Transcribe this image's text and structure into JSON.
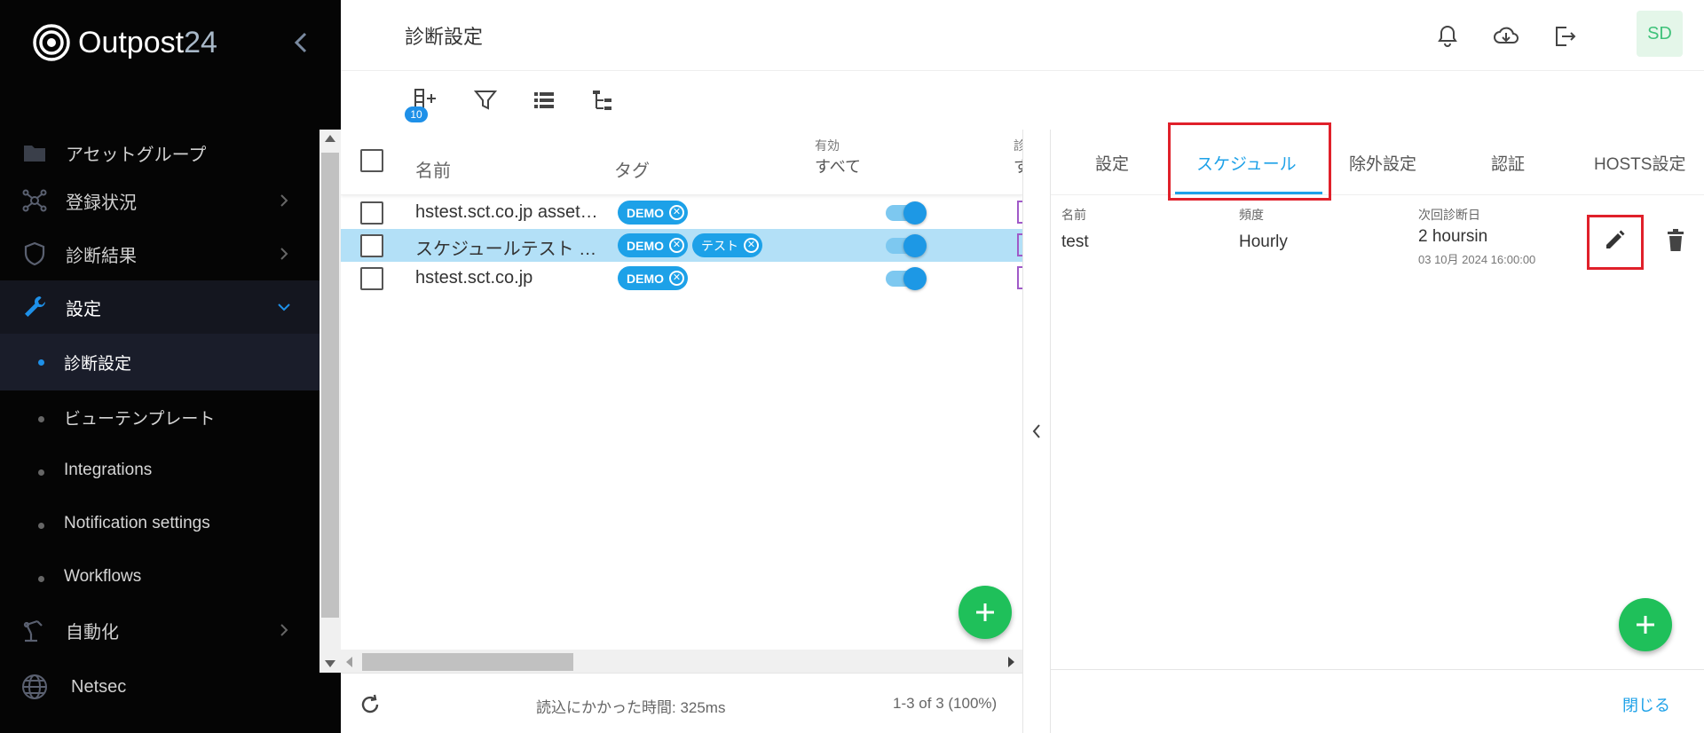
{
  "brand": {
    "name": "Outpost",
    "number": "24"
  },
  "sidebar": {
    "items": [
      {
        "label": "アセットグループ",
        "icon": "folder-icon"
      },
      {
        "label": "登録状況",
        "icon": "network-icon"
      },
      {
        "label": "診断結果",
        "icon": "shield-icon"
      },
      {
        "label": "設定",
        "icon": "wrench-icon"
      }
    ],
    "settings_sub": [
      {
        "label": "診断設定"
      },
      {
        "label": "ビューテンプレート"
      },
      {
        "label": "Integrations"
      },
      {
        "label": "Notification settings"
      },
      {
        "label": "Workflows"
      }
    ],
    "automation": {
      "label": "自動化"
    },
    "netsec": {
      "label": "Netsec"
    }
  },
  "header": {
    "title": "診断設定",
    "avatar": "SD"
  },
  "toolbar": {
    "badge": "10"
  },
  "table": {
    "headers": {
      "name": "名前",
      "tag": "タグ",
      "enabled_small": "有効",
      "enabled": "すべて",
      "cut_small": "診",
      "cut": "す"
    },
    "rows": [
      {
        "name": "hstest.sct.co.jp asset…",
        "tags": [
          "DEMO"
        ]
      },
      {
        "name": "スケジュールテスト …",
        "tags": [
          "DEMO",
          "テスト"
        ]
      },
      {
        "name": "hstest.sct.co.jp",
        "tags": [
          "DEMO"
        ]
      }
    ]
  },
  "footer": {
    "load_time": "読込にかかった時間: 325ms",
    "count": "1-3 of 3 (100%)"
  },
  "detail": {
    "tabs": [
      "設定",
      "スケジュール",
      "除外設定",
      "認証",
      "HOSTS設定"
    ],
    "schedule": {
      "labels": {
        "name": "名前",
        "frequency": "頻度",
        "next": "次回診断日"
      },
      "name": "test",
      "frequency": "Hourly",
      "next": "2 hoursin",
      "next_date": "03 10月 2024 16:00:00"
    },
    "close_label": "閉じる"
  },
  "colors": {
    "accent": "#1da1e8",
    "fab": "#1fc05a",
    "highlight": "#e0202a"
  }
}
